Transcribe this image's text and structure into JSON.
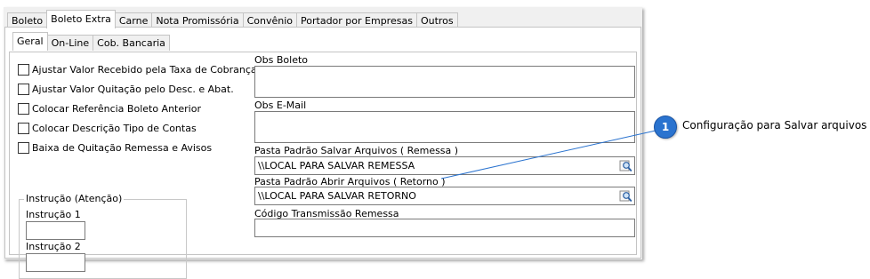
{
  "outer_tabs": [
    "Boleto",
    "Boleto Extra",
    "Carne",
    "Nota Promissória",
    "Convênio",
    "Portador por Empresas",
    "Outros"
  ],
  "inner_tabs": [
    "Geral",
    "On-Line",
    "Cob. Bancaria"
  ],
  "checkboxes": [
    "Ajustar Valor Recebido pela Taxa de Cobrança",
    "Ajustar Valor Quitação pelo Desc. e Abat.",
    "Colocar Referência Boleto Anterior",
    "Colocar Descrição Tipo de Contas",
    "Baixa de Quitação Remessa e Avisos"
  ],
  "instrucao": {
    "legend": "Instrução (Atenção)",
    "field1_label": "Instrução 1",
    "field1_value": "",
    "field2_label": "Instrução 2",
    "field2_value": ""
  },
  "obs_boleto": {
    "label": "Obs Boleto",
    "value": ""
  },
  "obs_email": {
    "label": "Obs E-Mail",
    "value": ""
  },
  "pasta_remessa": {
    "label": "Pasta Padrão Salvar Arquivos ( Remessa )",
    "value": "\\\\LOCAL PARA SALVAR REMESSA"
  },
  "pasta_retorno": {
    "label": "Pasta Padrão Abrir Arquivos ( Retorno )",
    "value": "\\\\LOCAL PARA SALVAR RETORNO"
  },
  "codigo_transmissao": {
    "label": "Código Transmissão Remessa",
    "value": ""
  },
  "callout": {
    "number": "1",
    "text": "Configuração para Salvar arquivos"
  },
  "colors": {
    "callout": "#2a73cf",
    "line": "#2a73cf"
  },
  "icons": {
    "lookup": "folder-search-icon"
  }
}
